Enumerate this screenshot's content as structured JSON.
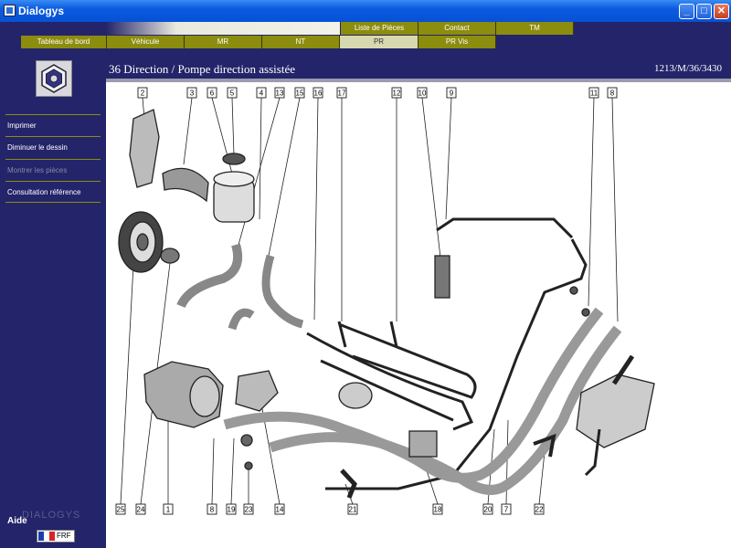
{
  "window": {
    "title": "Dialogys",
    "icon": "app-icon",
    "controls": [
      "minimize-icon",
      "maximize-icon",
      "close-icon"
    ]
  },
  "top_tabs": [
    "Liste de Pièces",
    "Contact",
    "TM"
  ],
  "nav_tabs": [
    "Tableau de bord",
    "Véhicule",
    "MR",
    "NT",
    "PR",
    "PR Vis"
  ],
  "nav_tabs_selected": "PR",
  "sidebar": {
    "logo_icon": "hexagon-nut-icon",
    "items": [
      {
        "label": "Imprimer",
        "enabled": true
      },
      {
        "label": "Diminuer le dessin",
        "enabled": true
      },
      {
        "label": "Montrer les pièces",
        "enabled": false
      },
      {
        "label": "Consultation référence",
        "enabled": true
      }
    ],
    "brand": "DIALOGYS",
    "help_label": "Aide",
    "language_code": "FRF",
    "language_icon": "france-flag-icon"
  },
  "content": {
    "title": "36 Direction / Pompe direction assistée",
    "reference": "1213/M/36/3430"
  },
  "diagram": {
    "callouts_top": [
      "2",
      "3",
      "6",
      "5",
      "4",
      "13",
      "15",
      "16",
      "17",
      "12",
      "10",
      "9",
      "11",
      "8"
    ],
    "callouts_bottom": [
      "25",
      "24",
      "1",
      "8",
      "19",
      "23",
      "14",
      "21",
      "18",
      "20",
      "7",
      "22"
    ]
  },
  "colors": {
    "window_blue": "#0651d6",
    "panel_navy": "#24246a",
    "tab_olive": "#8c8c0e",
    "tab_selected": "#d8d8b0"
  }
}
